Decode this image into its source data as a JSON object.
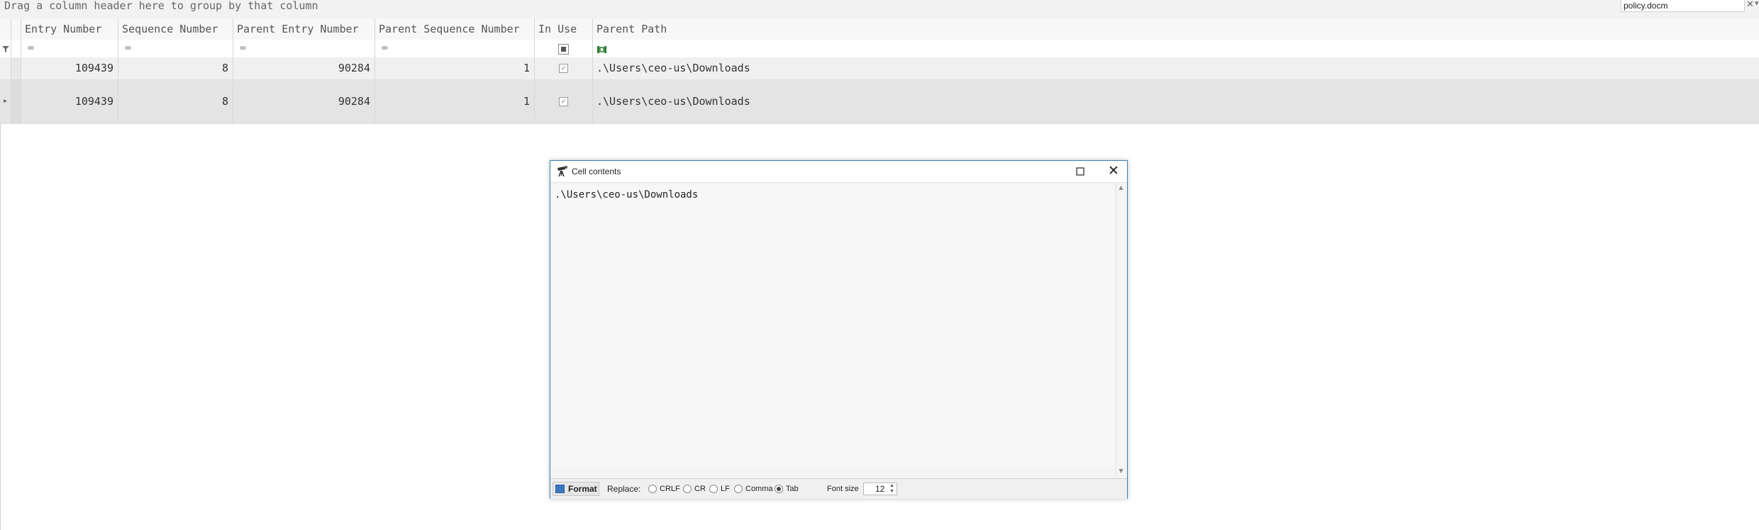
{
  "group_panel": {
    "hint": "Drag a column header here to group by that column",
    "search_value": "policy.docm",
    "clear_glyph": "✕",
    "options_glyph": "▾"
  },
  "grid": {
    "columns": [
      "Entry Number",
      "Sequence Number",
      "Parent Entry Number",
      "Parent Sequence Number",
      "In Use",
      "Parent Path"
    ],
    "filter_ops": [
      "=",
      "=",
      "=",
      "="
    ],
    "rows": [
      {
        "entry_number": "109439",
        "sequence_number": "8",
        "parent_entry_number": "90284",
        "parent_sequence_number": "1",
        "in_use": true,
        "parent_path": ".\\Users\\ceo-us\\Downloads"
      },
      {
        "entry_number": "109439",
        "sequence_number": "8",
        "parent_entry_number": "90284",
        "parent_sequence_number": "1",
        "in_use": true,
        "parent_path": ".\\Users\\ceo-us\\Downloads"
      }
    ],
    "row_indicator": "▸",
    "filter_icon": "filter-icon"
  },
  "dialog": {
    "title": "Cell contents",
    "content": ".\\Users\\ceo-us\\Downloads",
    "footer": {
      "format_label": "Format",
      "replace_label": "Replace:",
      "options": [
        "CRLF",
        "CR",
        "LF",
        "Comma",
        "Tab"
      ],
      "selected": "Tab",
      "font_size_label": "Font size",
      "font_size_value": "12"
    }
  },
  "colors": {
    "dialog_border": "#3c7fb1",
    "selected_row": "#e4e4e4"
  }
}
